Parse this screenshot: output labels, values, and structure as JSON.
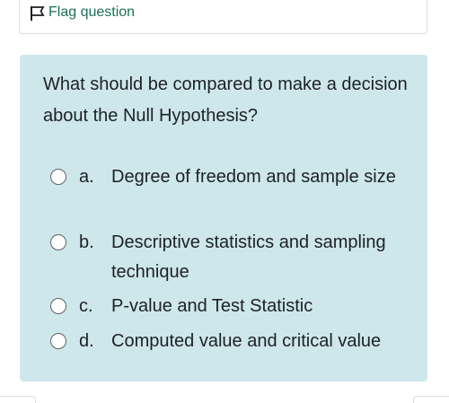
{
  "flag": {
    "label": "Flag question",
    "icon": "flag-outline-icon",
    "color": "#1b6f57"
  },
  "question": {
    "text": "What should be compared to make a decision about the Null Hypothesis?",
    "background_color": "#cee7eb",
    "answers": [
      {
        "letter": "a.",
        "text": "Degree of freedom and sample size",
        "selected": false
      },
      {
        "letter": "b.",
        "text": "Descriptive statistics and sampling technique",
        "selected": false
      },
      {
        "letter": "c.",
        "text": "P-value and Test Statistic",
        "selected": false
      },
      {
        "letter": "d.",
        "text": "Computed value and critical value",
        "selected": false
      }
    ]
  }
}
